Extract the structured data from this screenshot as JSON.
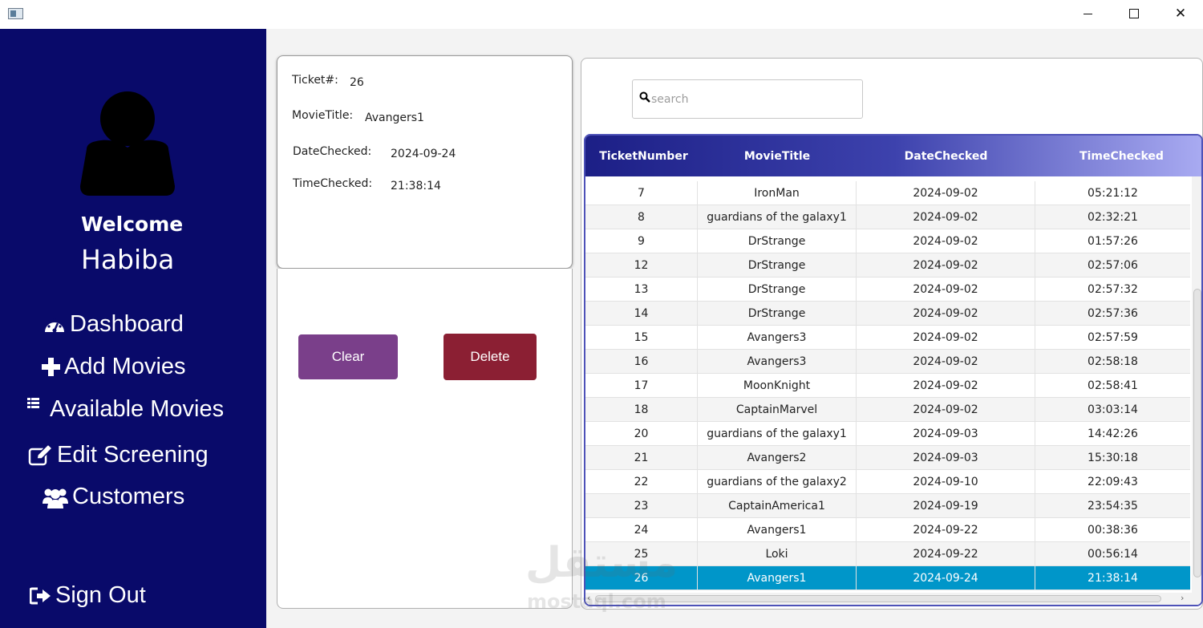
{
  "window": {
    "minimize_icon": "minimize-icon",
    "maximize_icon": "maximize-icon",
    "close_icon": "close-icon",
    "close_glyph": "✕"
  },
  "sidebar": {
    "welcome": "Welcome",
    "username": "Habiba",
    "nav": [
      {
        "label": "Dashboard",
        "icon": "dashboard-icon"
      },
      {
        "label": "Add Movies",
        "icon": "plus-icon"
      },
      {
        "label": "Available Movies",
        "icon": "list-icon"
      },
      {
        "label": "Edit Screening",
        "icon": "edit-icon"
      },
      {
        "label": "Customers",
        "icon": "users-icon"
      }
    ],
    "sign_out": {
      "label": "Sign Out",
      "icon": "sign-out-icon"
    },
    "bg_color": "#090a6a"
  },
  "details": {
    "ticket_label": "Ticket#:",
    "ticket_value": "26",
    "movie_label": "MovieTitle:",
    "movie_value": "Avangers1",
    "date_label": "DateChecked:",
    "date_value": "2024-09-24",
    "time_label": "TimeChecked:",
    "time_value": "21:38:14"
  },
  "actions": {
    "clear_label": "Clear",
    "delete_label": "Delete",
    "clear_color": "#7a3f8a",
    "delete_color": "#8b1f33"
  },
  "search": {
    "placeholder": "search",
    "icon": "search-icon"
  },
  "table": {
    "columns": [
      "TicketNumber",
      "MovieTitle",
      "DateChecked",
      "TimeChecked"
    ],
    "rows": [
      [
        "7",
        "IronMan",
        "2024-09-02",
        "05:21:12"
      ],
      [
        "8",
        "guardians of the galaxy1",
        "2024-09-02",
        "02:32:21"
      ],
      [
        "9",
        "DrStrange",
        "2024-09-02",
        "01:57:26"
      ],
      [
        "12",
        "DrStrange",
        "2024-09-02",
        "02:57:06"
      ],
      [
        "13",
        "DrStrange",
        "2024-09-02",
        "02:57:32"
      ],
      [
        "14",
        "DrStrange",
        "2024-09-02",
        "02:57:36"
      ],
      [
        "15",
        "Avangers3",
        "2024-09-02",
        "02:57:59"
      ],
      [
        "16",
        "Avangers3",
        "2024-09-02",
        "02:58:18"
      ],
      [
        "17",
        "MoonKnight",
        "2024-09-02",
        "02:58:41"
      ],
      [
        "18",
        "CaptainMarvel",
        "2024-09-02",
        "03:03:14"
      ],
      [
        "20",
        "guardians of the galaxy1",
        "2024-09-03",
        "14:42:26"
      ],
      [
        "21",
        "Avangers2",
        "2024-09-03",
        "15:30:18"
      ],
      [
        "22",
        "guardians of the galaxy2",
        "2024-09-10",
        "22:09:43"
      ],
      [
        "23",
        "CaptainAmerica1",
        "2024-09-19",
        "23:54:35"
      ],
      [
        "24",
        "Avangers1",
        "2024-09-22",
        "00:38:36"
      ],
      [
        "25",
        "Loki",
        "2024-09-22",
        "00:56:14"
      ],
      [
        "26",
        "Avangers1",
        "2024-09-24",
        "21:38:14"
      ]
    ],
    "selected_ticket": "26",
    "selected_color": "#0096c9",
    "header_gradient": [
      "#1c1f86",
      "#3d42ad",
      "#a9abf2"
    ]
  },
  "watermark": {
    "logo": "مستقل",
    "text": "mostaql.com"
  }
}
